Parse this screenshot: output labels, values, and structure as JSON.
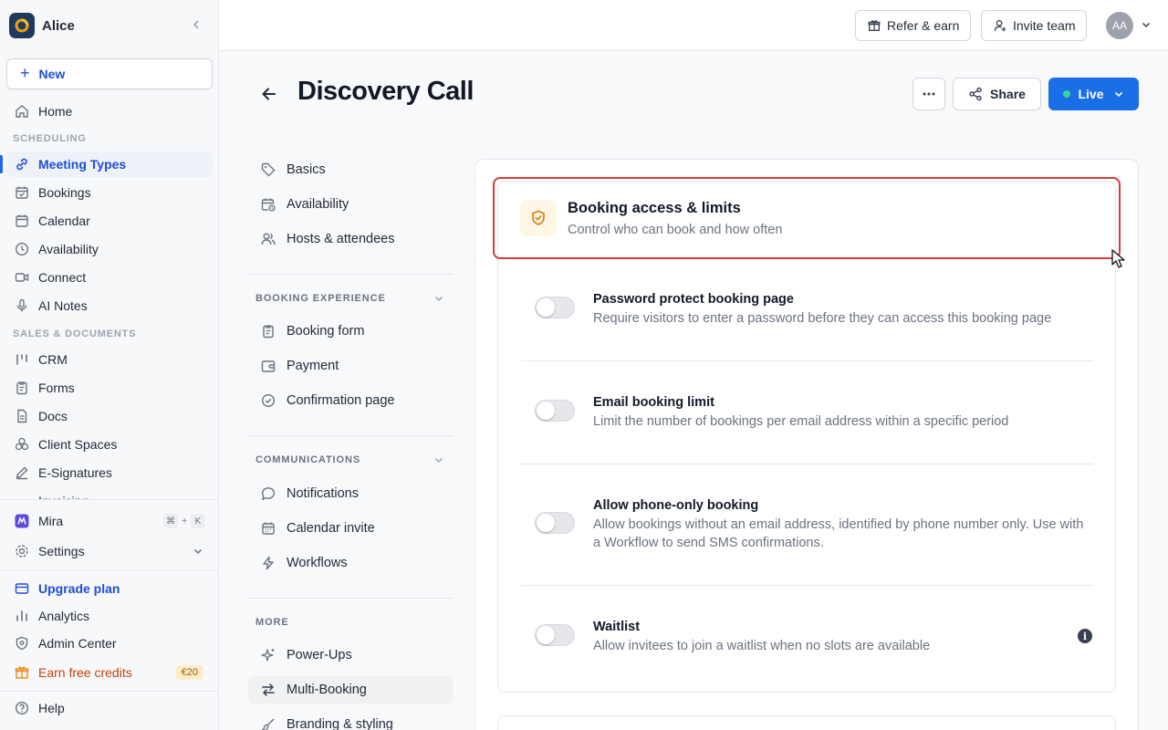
{
  "workspace": {
    "name": "Alice"
  },
  "sidebar": {
    "new_label": "New",
    "items": [
      {
        "label": "Home",
        "icon": "home-icon"
      },
      {
        "label": "Meeting Types",
        "icon": "link-icon"
      },
      {
        "label": "Bookings",
        "icon": "calendar-check-icon"
      },
      {
        "label": "Calendar",
        "icon": "calendar-icon"
      },
      {
        "label": "Availability",
        "icon": "clock-icon"
      },
      {
        "label": "Connect",
        "icon": "video-icon"
      },
      {
        "label": "AI Notes",
        "icon": "microphone-icon"
      },
      {
        "label": "CRM",
        "icon": "crm-icon"
      },
      {
        "label": "Forms",
        "icon": "clipboard-icon"
      },
      {
        "label": "Docs",
        "icon": "document-icon"
      },
      {
        "label": "Client Spaces",
        "icon": "boxes-icon"
      },
      {
        "label": "E-Signatures",
        "icon": "pen-icon"
      },
      {
        "label": "Invoicing",
        "icon": "invoice-icon"
      }
    ],
    "sections": {
      "scheduling": "SCHEDULING",
      "sales": "SALES & DOCUMENTS"
    },
    "mira": {
      "label": "Mira",
      "shortcut_mod": "⌘",
      "shortcut_plus": "+",
      "shortcut_key": "K"
    },
    "settings": "Settings",
    "upgrade": "Upgrade plan",
    "analytics": "Analytics",
    "admin": "Admin Center",
    "earn": {
      "label": "Earn free credits",
      "badge": "€20"
    },
    "help": "Help"
  },
  "topbar": {
    "refer": "Refer & earn",
    "invite": "Invite team",
    "avatar": "AA"
  },
  "header": {
    "title": "Discovery Call",
    "share": "Share",
    "live": "Live"
  },
  "subnav": {
    "top": [
      "Basics",
      "Availability",
      "Hosts & attendees"
    ],
    "booking_experience": {
      "title": "BOOKING EXPERIENCE",
      "items": [
        "Booking form",
        "Payment",
        "Confirmation page"
      ]
    },
    "communications": {
      "title": "COMMUNICATIONS",
      "items": [
        "Notifications",
        "Calendar invite",
        "Workflows"
      ]
    },
    "more": {
      "title": "MORE",
      "items": [
        "Power-Ups",
        "Multi-Booking",
        "Branding & styling"
      ]
    }
  },
  "section": {
    "title": "Booking access & limits",
    "subtitle": "Control who can book and how often",
    "rows": [
      {
        "title": "Password protect booking page",
        "desc": "Require visitors to enter a password before they can access this booking page",
        "enabled": false
      },
      {
        "title": "Email booking limit",
        "desc": "Limit the number of bookings per email address within a specific period",
        "enabled": false
      },
      {
        "title": "Allow phone-only booking",
        "desc": "Allow bookings without an email address, identified by phone number only. Use with a Workflow to send SMS confirmations.",
        "enabled": false
      },
      {
        "title": "Waitlist",
        "desc": "Allow invitees to join a waitlist when no slots are available",
        "enabled": false
      }
    ]
  },
  "colors": {
    "accent": "#1a6ee8",
    "highlight": "#dc3b3b",
    "live_dot": "#34d399"
  }
}
